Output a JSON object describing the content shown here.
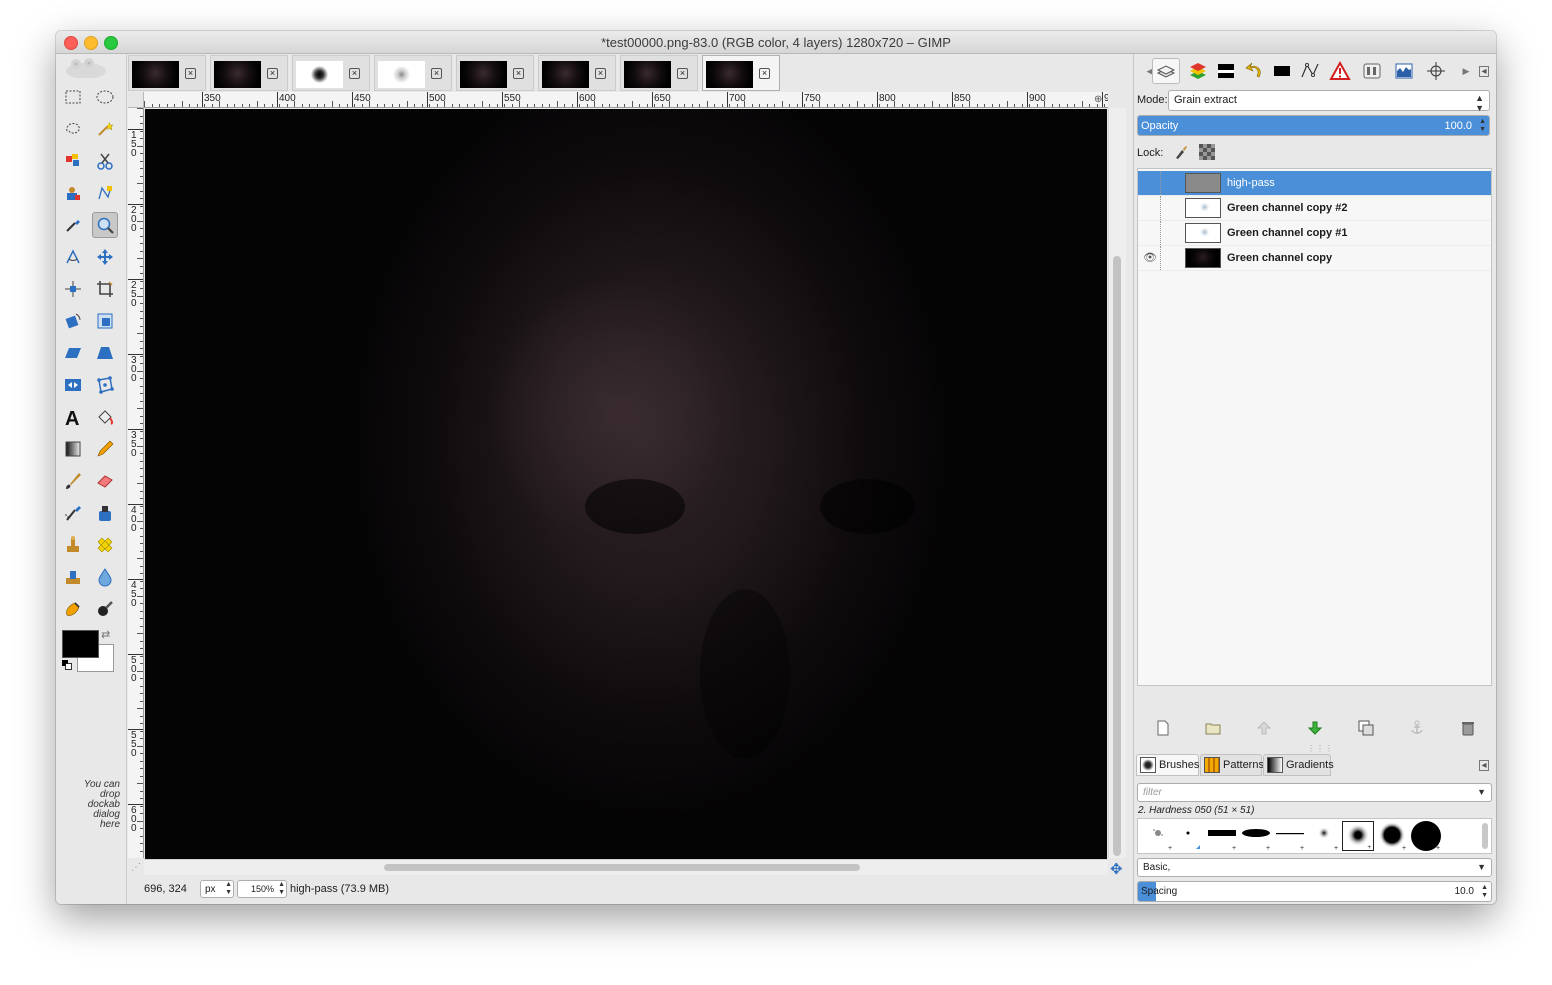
{
  "window": {
    "title": "*test00000.png-83.0 (RGB color, 4 layers) 1280x720 – GIMP"
  },
  "colors": {
    "selection_blue": "#4a8fd8",
    "foreground": "#000000",
    "background": "#ffffff"
  },
  "toolbox": {
    "tools": [
      "rect-select-icon",
      "ellipse-select-icon",
      "free-select-icon",
      "fuzzy-select-icon",
      "color-select-icon",
      "scissors-select-icon",
      "foreground-select-icon",
      "paths-icon",
      "color-picker-icon",
      "zoom-icon",
      "measure-icon",
      "move-icon",
      "align-icon",
      "crop-icon",
      "rotate-icon",
      "scale-icon",
      "shear-icon",
      "perspective-icon",
      "flip-icon",
      "cage-transform-icon",
      "text-icon",
      "bucket-fill-icon",
      "blend-icon",
      "pencil-icon",
      "paintbrush-icon",
      "eraser-icon",
      "airbrush-icon",
      "ink-icon",
      "clone-icon",
      "heal-icon",
      "perspective-clone-icon",
      "blur-icon",
      "smudge-icon",
      "dodge-burn-icon"
    ],
    "drop_hint": "You can drop dockab dialog here"
  },
  "image_tabs": [
    {
      "name": "image-tab-1",
      "thumb": "dark"
    },
    {
      "name": "image-tab-2",
      "thumb": "dark"
    },
    {
      "name": "image-tab-3",
      "thumb": "light"
    },
    {
      "name": "image-tab-4",
      "thumb": "light-faint"
    },
    {
      "name": "image-tab-5",
      "thumb": "dark"
    },
    {
      "name": "image-tab-6",
      "thumb": "dark"
    },
    {
      "name": "image-tab-7",
      "thumb": "dark"
    },
    {
      "name": "image-tab-8",
      "thumb": "dark",
      "active": true
    }
  ],
  "rulers": {
    "horizontal": [
      "350",
      "400",
      "450",
      "500",
      "550",
      "600",
      "650",
      "700",
      "750",
      "800",
      "850",
      "900",
      "9"
    ],
    "vertical": [
      "150",
      "200",
      "250",
      "300",
      "350",
      "400",
      "450",
      "500",
      "550",
      "600"
    ]
  },
  "status": {
    "coordinates": "696, 324",
    "unit": "px",
    "zoom": "150%",
    "message": "high-pass (73.9 MB)"
  },
  "layers_panel": {
    "mode_label": "Mode:",
    "mode_value": "Grain extract",
    "opacity_label": "Opacity",
    "opacity_value": "100.0",
    "opacity_fraction": 1.0,
    "lock_label": "Lock:",
    "layers": [
      {
        "name": "high-pass",
        "selected": true,
        "visible": false,
        "thumb": "gray"
      },
      {
        "name": "Green channel copy #2",
        "selected": false,
        "visible": false,
        "thumb": "white-spot"
      },
      {
        "name": "Green channel copy #1",
        "selected": false,
        "visible": false,
        "thumb": "white-spot"
      },
      {
        "name": "Green channel copy",
        "selected": false,
        "visible": true,
        "thumb": "dark"
      }
    ]
  },
  "brushes_panel": {
    "tabs": [
      "Brushes",
      "Patterns",
      "Gradients"
    ],
    "filter_placeholder": "filter",
    "selected_brush": "2. Hardness 050 (51 × 51)",
    "tag_value": "Basic,",
    "spacing_label": "Spacing",
    "spacing_value": "10.0",
    "spacing_fraction": 0.05
  }
}
